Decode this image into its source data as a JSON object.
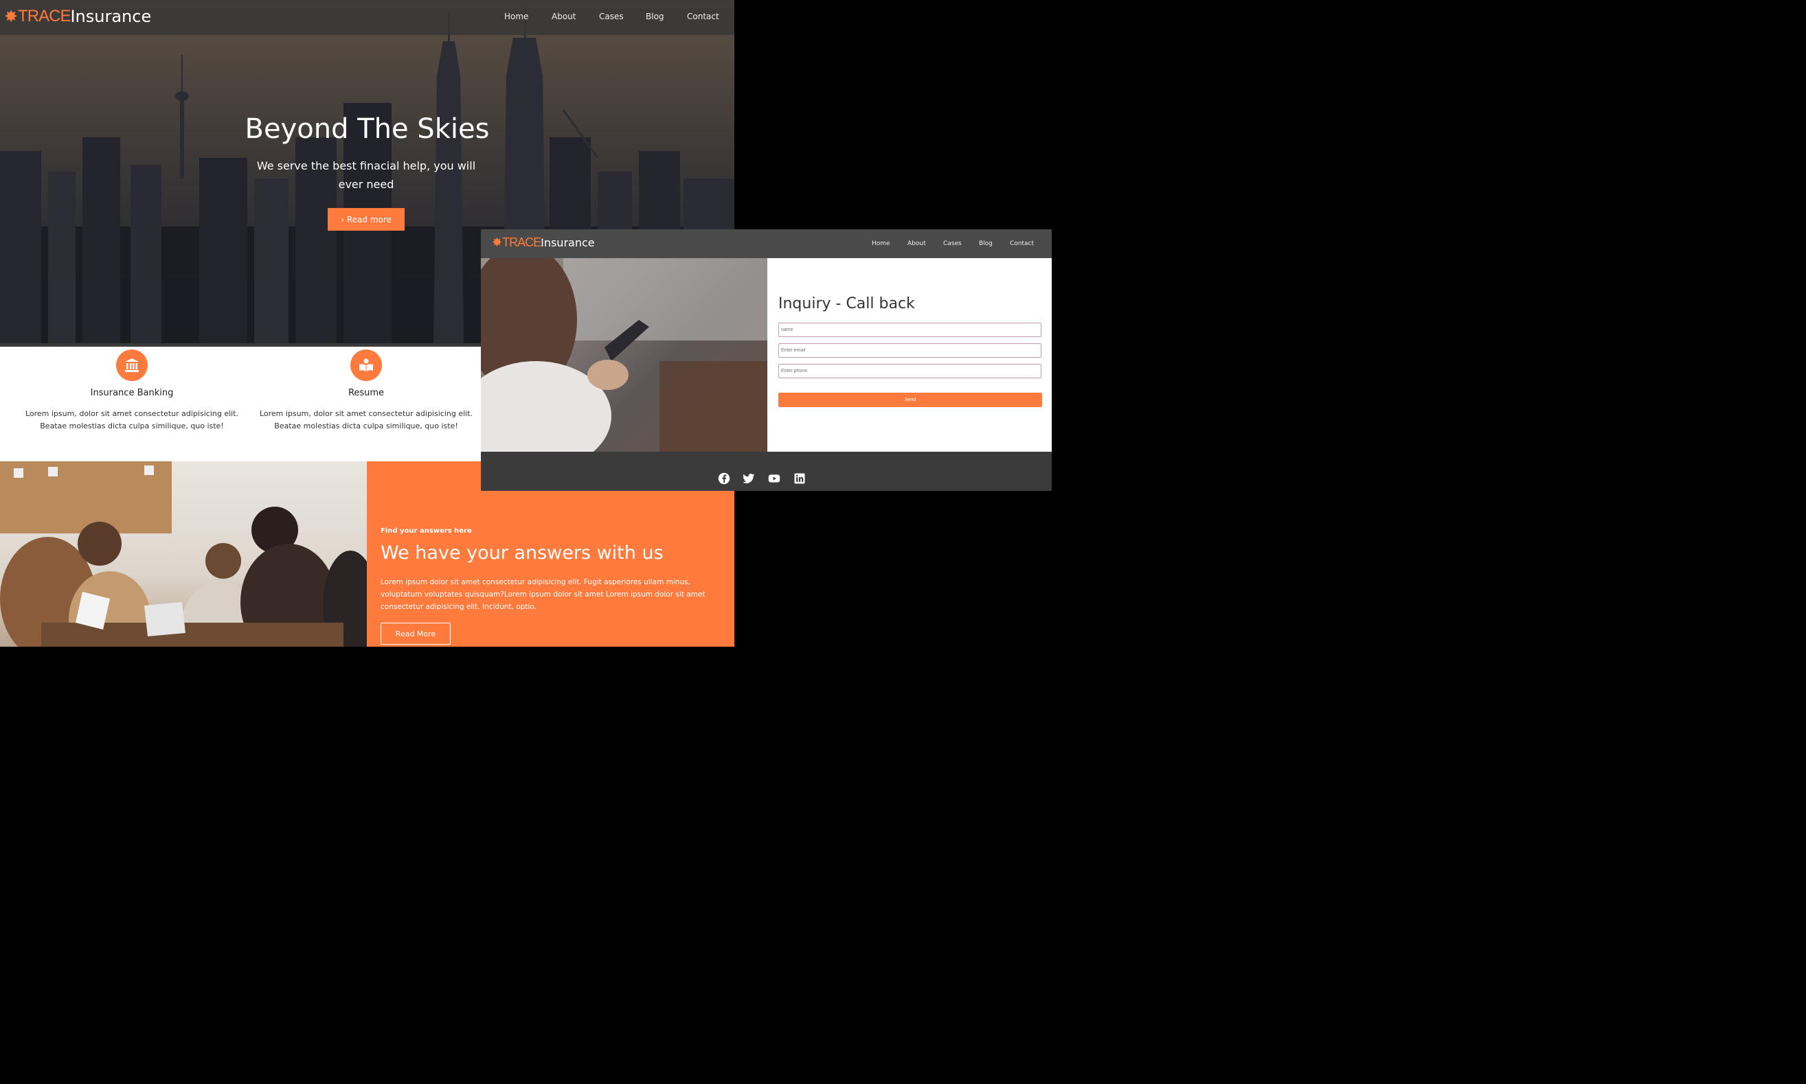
{
  "brand": {
    "trace": "TRACE",
    "insurance": "Insurance"
  },
  "nav": [
    "Home",
    "About",
    "Cases",
    "Blog",
    "Contact"
  ],
  "hero": {
    "title": "Beyond The Skies",
    "subtitle": "We serve the best finacial help, you will ever need",
    "button": "Read more"
  },
  "features": [
    {
      "title": "Insurance Banking",
      "icon": "bank-icon",
      "text": "Lorem ipsum, dolor sit amet consectetur adipisicing elit. Beatae molestias dicta culpa similique, quo iste!"
    },
    {
      "title": "Resume",
      "icon": "book-reader-icon",
      "text": "Lorem ipsum, dolor sit amet consectetur adipisicing elit. Beatae molestias dicta culpa similique, quo iste!"
    }
  ],
  "answers": {
    "kicker": "Find your answers here",
    "title": "We have your answers with us",
    "text": "Lorem ipsum dolor sit amet consectetur adipisicing elit. Fugit asperiores ullam minus, voluptatum voluptates quisquam?Lorem ipsum dolor sit amet Lorem ipsum dolor sit amet consectetur adipisicing elit. Incidunt, optio.",
    "button": "Read More"
  },
  "inquiry": {
    "title": "Inquiry - Call back",
    "name_placeholder": "name",
    "email_placeholder": "Enter email",
    "phone_placeholder": "Enter phone",
    "send": "Send"
  },
  "social": [
    "facebook-icon",
    "twitter-icon",
    "youtube-icon",
    "linkedin-icon"
  ],
  "colors": {
    "accent": "#ff7a3d",
    "navbar": "#4a4a4a",
    "footer": "#3b3b3b"
  }
}
